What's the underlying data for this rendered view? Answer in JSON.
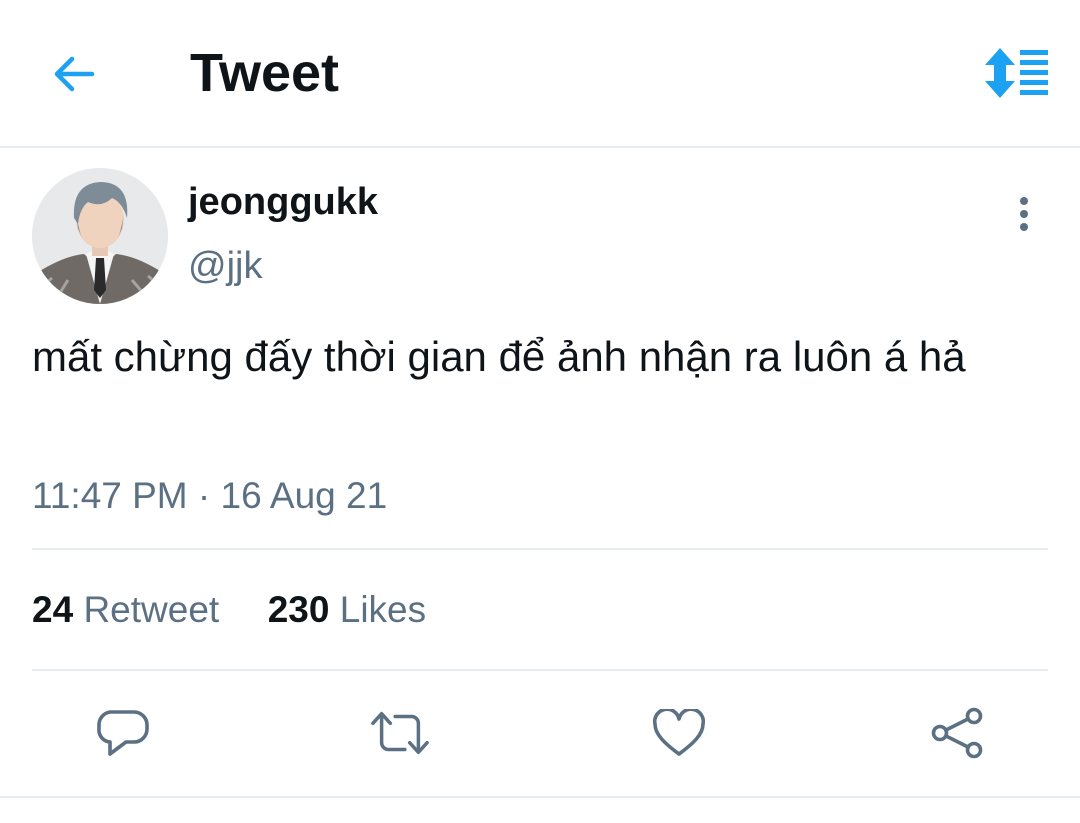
{
  "header": {
    "title": "Tweet",
    "back_icon": "arrow-left-icon",
    "sort_icon": "sort-reply-icon",
    "accent_color": "#1da1f2"
  },
  "tweet": {
    "display_name": "jeonggukk",
    "handle": "@jjk",
    "text": "mất chừng đấy thời gian để ảnh nhận ra luôn á hả",
    "timestamp": "11:47 PM · 16 Aug 21",
    "more_icon": "more-vertical-icon"
  },
  "stats": {
    "retweets_count": "24",
    "retweets_label": "Retweet",
    "likes_count": "230",
    "likes_label": "Likes"
  },
  "actions": {
    "reply_icon": "reply-icon",
    "retweet_icon": "retweet-icon",
    "like_icon": "heart-icon",
    "share_icon": "share-icon"
  }
}
